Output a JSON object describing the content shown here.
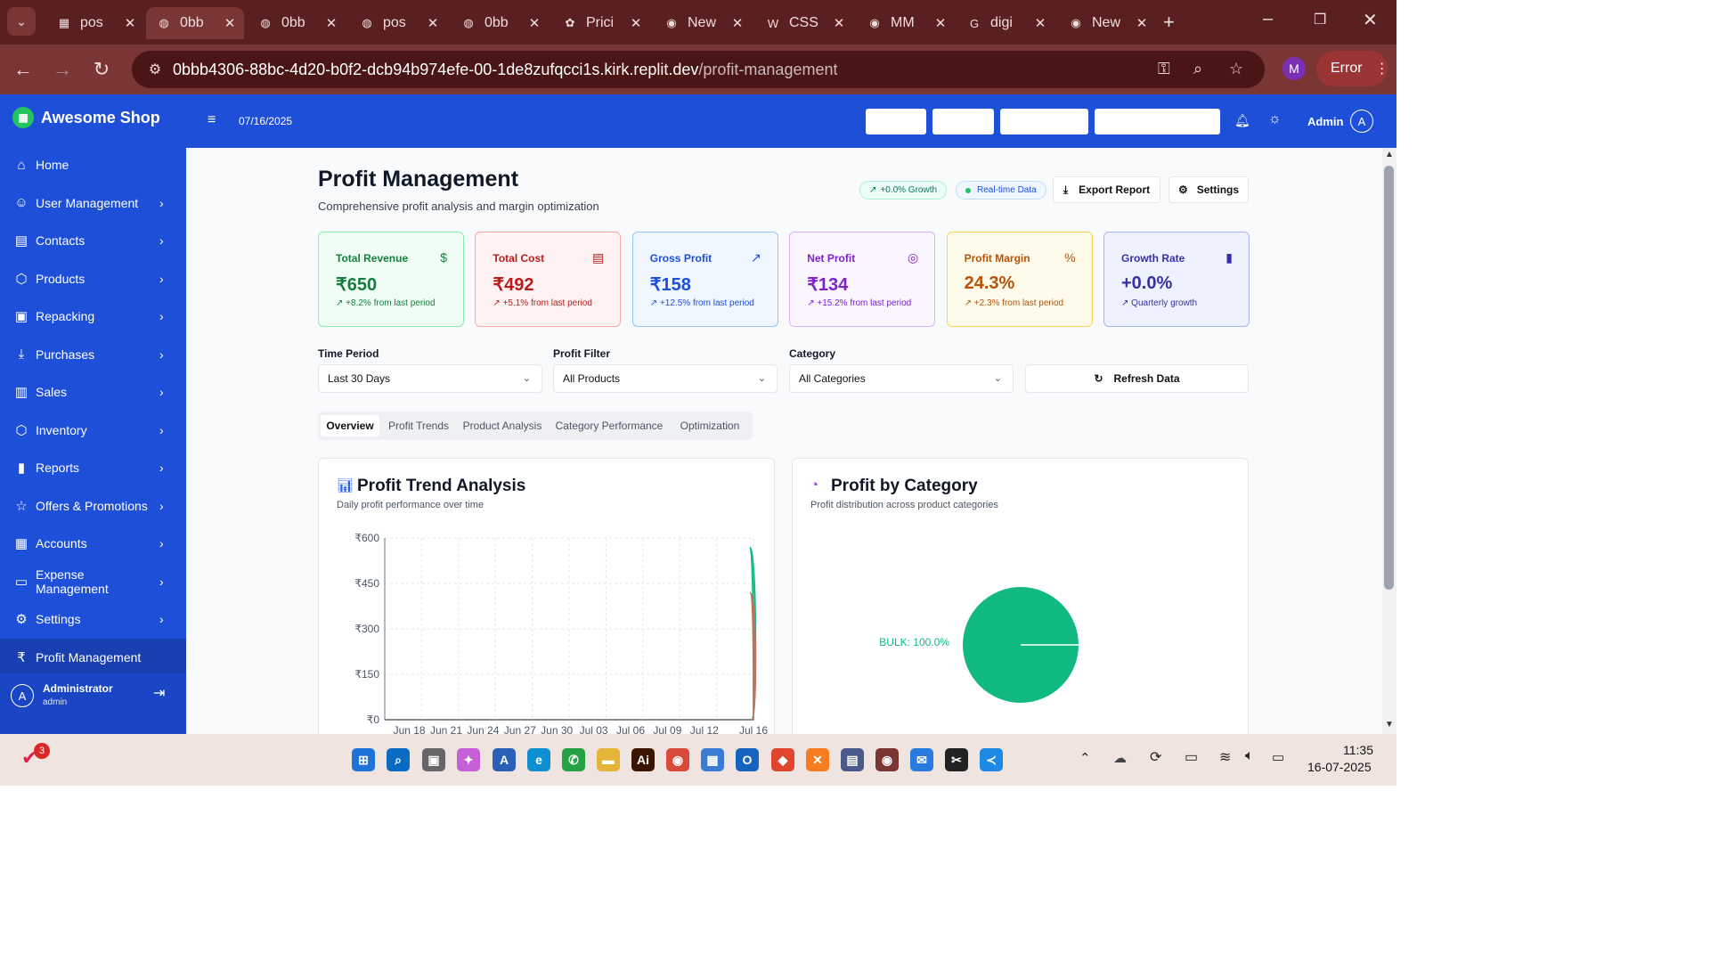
{
  "browser": {
    "tabs": [
      {
        "label": "pos",
        "icon": "grid-favicon-icon",
        "active": false
      },
      {
        "label": "0bb",
        "icon": "globe-icon",
        "active": true
      },
      {
        "label": "0bb",
        "icon": "globe-icon",
        "active": false
      },
      {
        "label": "pos",
        "icon": "globe-icon",
        "active": false
      },
      {
        "label": "0bb",
        "icon": "globe-icon",
        "active": false
      },
      {
        "label": "Prici",
        "icon": "chatgpt-icon",
        "active": false
      },
      {
        "label": "New",
        "icon": "chrome-icon",
        "active": false
      },
      {
        "label": "CSS",
        "icon": "w-favicon-icon",
        "active": false
      },
      {
        "label": "MM",
        "icon": "chrome-icon",
        "active": false
      },
      {
        "label": "digi",
        "icon": "google-icon",
        "active": false
      },
      {
        "label": "New",
        "icon": "chrome-icon",
        "active": false
      }
    ],
    "url_host": "0bbb4306-88bc-4d20-b0f2-dcb94b974efe-00-1de8zufqcci1s.kirk.replit.dev",
    "url_path": "/profit-management",
    "profile_initial": "M",
    "error_label": "Error"
  },
  "sidebar": {
    "brand": "Awesome Shop",
    "items": [
      {
        "label": "Home",
        "icon": "home-icon",
        "chevron": false
      },
      {
        "label": "User Management",
        "icon": "user-icon",
        "chevron": true
      },
      {
        "label": "Contacts",
        "icon": "contacts-icon",
        "chevron": true
      },
      {
        "label": "Products",
        "icon": "box-icon",
        "chevron": true
      },
      {
        "label": "Repacking",
        "icon": "repacking-icon",
        "chevron": true
      },
      {
        "label": "Purchases",
        "icon": "download-icon",
        "chevron": true
      },
      {
        "label": "Sales",
        "icon": "cart-icon",
        "chevron": true
      },
      {
        "label": "Inventory",
        "icon": "box-icon",
        "chevron": true
      },
      {
        "label": "Reports",
        "icon": "bar-chart-icon",
        "chevron": true
      },
      {
        "label": "Offers & Promotions",
        "icon": "star-icon",
        "chevron": true
      },
      {
        "label": "Accounts",
        "icon": "calculator-icon",
        "chevron": true
      },
      {
        "label": "Expense Management",
        "icon": "wallet-icon",
        "chevron": true
      },
      {
        "label": "Settings",
        "icon": "gear-icon",
        "chevron": true
      },
      {
        "label": "Profit Management",
        "icon": "rupee-icon",
        "chevron": false,
        "active": true
      }
    ],
    "footer": {
      "avatar": "A",
      "name": "Administrator",
      "role": "admin"
    }
  },
  "topbar": {
    "date": "07/16/2025",
    "user": "Admin",
    "avatar": "A"
  },
  "page": {
    "title": "Profit Management",
    "subtitle": "Comprehensive profit analysis and margin optimization",
    "growth_badge": "+0.0% Growth",
    "realtime_badge": "Real-time Data",
    "export_label": "Export Report",
    "settings_label": "Settings"
  },
  "cards": [
    {
      "title": "Total Revenue",
      "value": "₹650",
      "sub": "+8.2% from last period",
      "icon": "dollar-icon",
      "color": "#15803d",
      "bg": "#f0fdf4",
      "border": "#86efac"
    },
    {
      "title": "Total Cost",
      "value": "₹492",
      "sub": "+5.1% from last period",
      "icon": "receipt-icon",
      "color": "#b91c1c",
      "bg": "#fef2f2",
      "border": "#fca5a5"
    },
    {
      "title": "Gross Profit",
      "value": "₹158",
      "sub": "+12.5% from last period",
      "icon": "trending-up-icon",
      "color": "#1d4ed8",
      "bg": "#eff6ff",
      "border": "#93c5fd"
    },
    {
      "title": "Net Profit",
      "value": "₹134",
      "sub": "+15.2% from last period",
      "icon": "target-icon",
      "color": "#7e22ce",
      "bg": "#faf5ff",
      "border": "#d8b4fe"
    },
    {
      "title": "Profit Margin",
      "value": "24.3%",
      "sub": "+2.3% from last period",
      "icon": "percent-icon",
      "color": "#b45309",
      "bg": "#fffbeb",
      "border": "#fcd34d"
    },
    {
      "title": "Growth Rate",
      "value": "+0.0%",
      "sub": "Quarterly growth",
      "icon": "bar-chart-icon",
      "color": "#3730a3",
      "bg": "#eef2ff",
      "border": "#a5b4fc"
    }
  ],
  "filters": {
    "time_period": {
      "label": "Time Period",
      "value": "Last 30 Days"
    },
    "profit_filter": {
      "label": "Profit Filter",
      "value": "All Products"
    },
    "category": {
      "label": "Category",
      "value": "All Categories"
    },
    "refresh_label": "Refresh Data"
  },
  "view_tabs": [
    "Overview",
    "Profit Trends",
    "Product Analysis",
    "Category Performance",
    "Optimization"
  ],
  "trend_panel": {
    "title": "Profit Trend Analysis",
    "subtitle": "Daily profit performance over time"
  },
  "category_panel": {
    "title": "Profit by Category",
    "subtitle": "Profit distribution across product categories"
  },
  "chart_data": [
    {
      "type": "area",
      "title": "Profit Trend Analysis",
      "x": [
        "Jun 16",
        "Jun 17",
        "Jun 18",
        "Jun 19",
        "Jun 20",
        "Jun 21",
        "Jun 22",
        "Jun 23",
        "Jun 24",
        "Jun 25",
        "Jun 26",
        "Jun 27",
        "Jun 28",
        "Jun 29",
        "Jun 30",
        "Jul 01",
        "Jul 02",
        "Jul 03",
        "Jul 04",
        "Jul 05",
        "Jul 06",
        "Jul 07",
        "Jul 08",
        "Jul 09",
        "Jul 10",
        "Jul 11",
        "Jul 12",
        "Jul 13",
        "Jul 14",
        "Jul 15",
        "Jul 16"
      ],
      "xticks": [
        "Jun 18",
        "Jun 21",
        "Jun 24",
        "Jun 27",
        "Jun 30",
        "Jul 03",
        "Jul 06",
        "Jul 09",
        "Jul 12",
        "Jul 16"
      ],
      "yticks": [
        "₹0",
        "₹150",
        "₹300",
        "₹450",
        "₹600"
      ],
      "ylim": [
        0,
        600
      ],
      "grid": true,
      "series": [
        {
          "color": "#10b981",
          "values": [
            0,
            0,
            0,
            0,
            0,
            0,
            0,
            0,
            0,
            0,
            0,
            0,
            0,
            0,
            0,
            0,
            0,
            0,
            0,
            0,
            0,
            0,
            0,
            0,
            0,
            0,
            0,
            0,
            0,
            0,
            570
          ]
        },
        {
          "color": "#c2705f",
          "values": [
            0,
            0,
            0,
            0,
            0,
            0,
            0,
            0,
            0,
            0,
            0,
            0,
            0,
            0,
            0,
            0,
            0,
            0,
            0,
            0,
            0,
            0,
            0,
            0,
            0,
            0,
            0,
            0,
            0,
            0,
            420
          ]
        }
      ]
    },
    {
      "type": "pie",
      "title": "Profit by Category",
      "categories": [
        "BULK"
      ],
      "values": [
        100.0
      ],
      "slice_labels": [
        "BULK: 100.0%"
      ],
      "colors": [
        "#10b981"
      ]
    }
  ],
  "taskbar": {
    "time": "11:35",
    "date": "16-07-2025",
    "badge": "3"
  }
}
